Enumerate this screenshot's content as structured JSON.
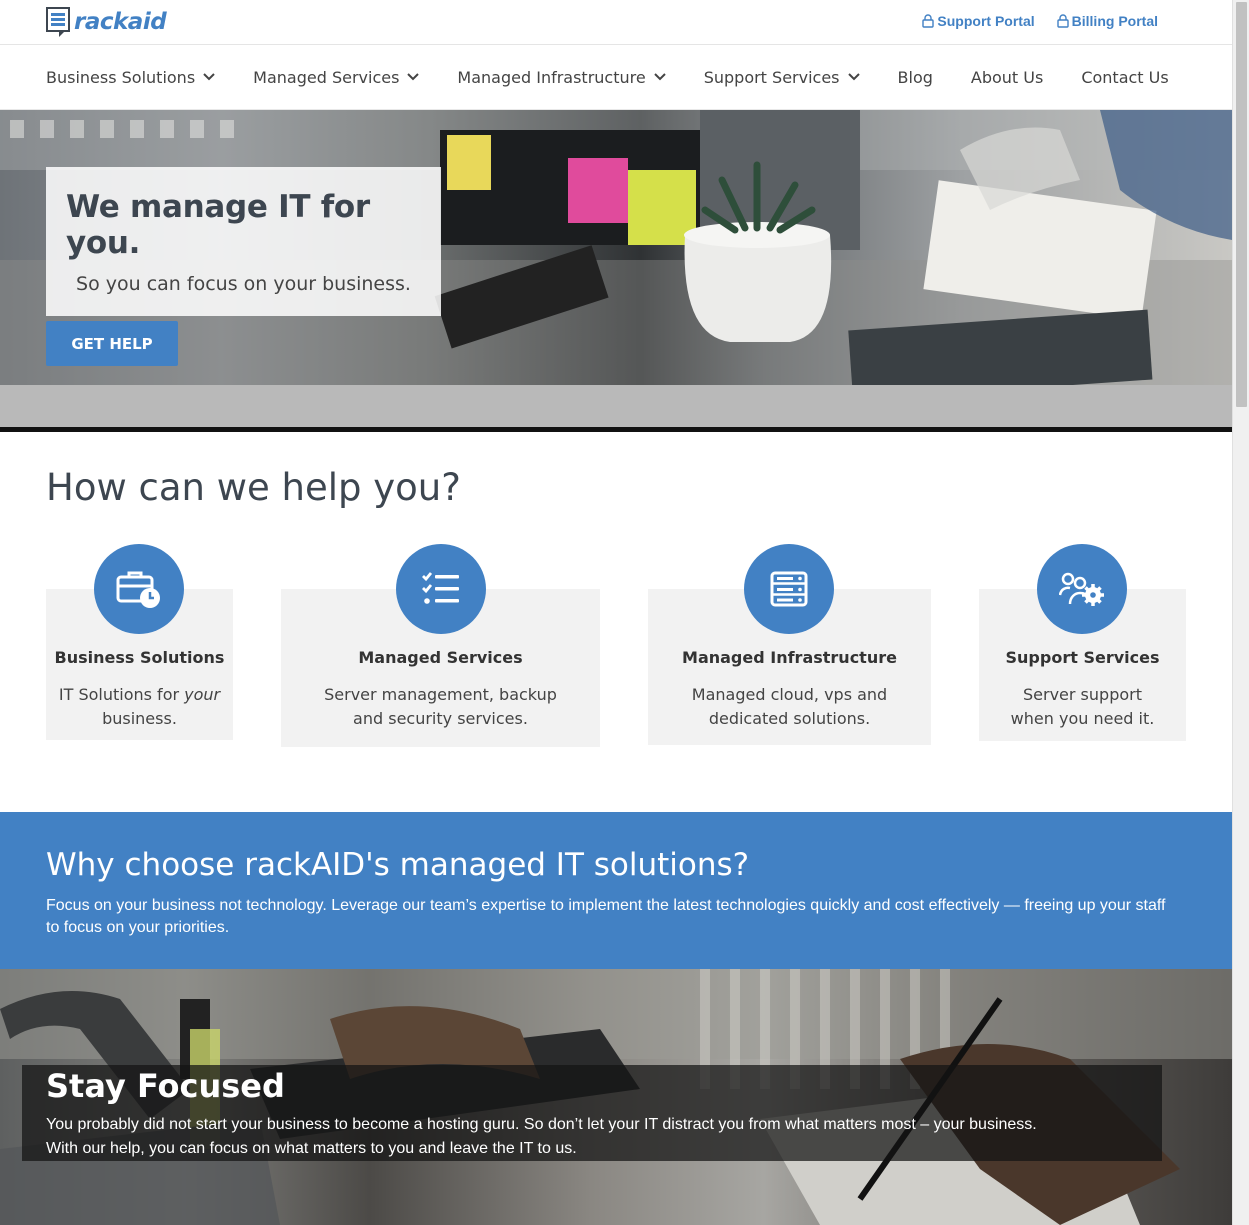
{
  "brand": {
    "name": "rackaid",
    "accent": "#4281c4"
  },
  "portals": [
    {
      "label": "Support Portal",
      "icon": "lock-icon"
    },
    {
      "label": "Billing Portal",
      "icon": "lock-icon"
    }
  ],
  "nav": [
    {
      "label": "Business Solutions",
      "dropdown": true
    },
    {
      "label": "Managed Services",
      "dropdown": true
    },
    {
      "label": "Managed Infrastructure",
      "dropdown": true
    },
    {
      "label": "Support Services",
      "dropdown": true
    },
    {
      "label": "Blog",
      "dropdown": false
    },
    {
      "label": "About Us",
      "dropdown": false
    },
    {
      "label": "Contact Us",
      "dropdown": false
    }
  ],
  "hero": {
    "title": "We manage IT for you.",
    "subtitle": "So you can focus on your business.",
    "cta": "GET HELP"
  },
  "help": {
    "title": "How can we help you?",
    "cards": [
      {
        "title": "Business Solutions",
        "desc_pre": "IT Solutions for ",
        "desc_em": "your",
        "desc_post": " business.",
        "icon": "briefcase-clock-icon"
      },
      {
        "title": "Managed Services",
        "desc": "Server management, backup and security services.",
        "icon": "checklist-icon"
      },
      {
        "title": "Managed Infrastructure",
        "desc": "Managed cloud, vps and dedicated solutions.",
        "icon": "server-icon"
      },
      {
        "title": "Support Services",
        "desc": "Server support when you need it.",
        "icon": "users-gear-icon"
      }
    ]
  },
  "why": {
    "title": "Why choose rackAID's managed IT solutions?",
    "text": "Focus on your business not technology.  Leverage our team’s expertise to implement the latest technologies quickly and cost effectively — freeing up your staff to focus on your priorities."
  },
  "focus": {
    "title": "Stay Focused",
    "line1": "You probably did not start your business to become a hosting guru.   So don’t let your IT distract you from what matters most – your business.",
    "line2": "With our help, you can focus on what matters to you and leave the IT to us."
  }
}
